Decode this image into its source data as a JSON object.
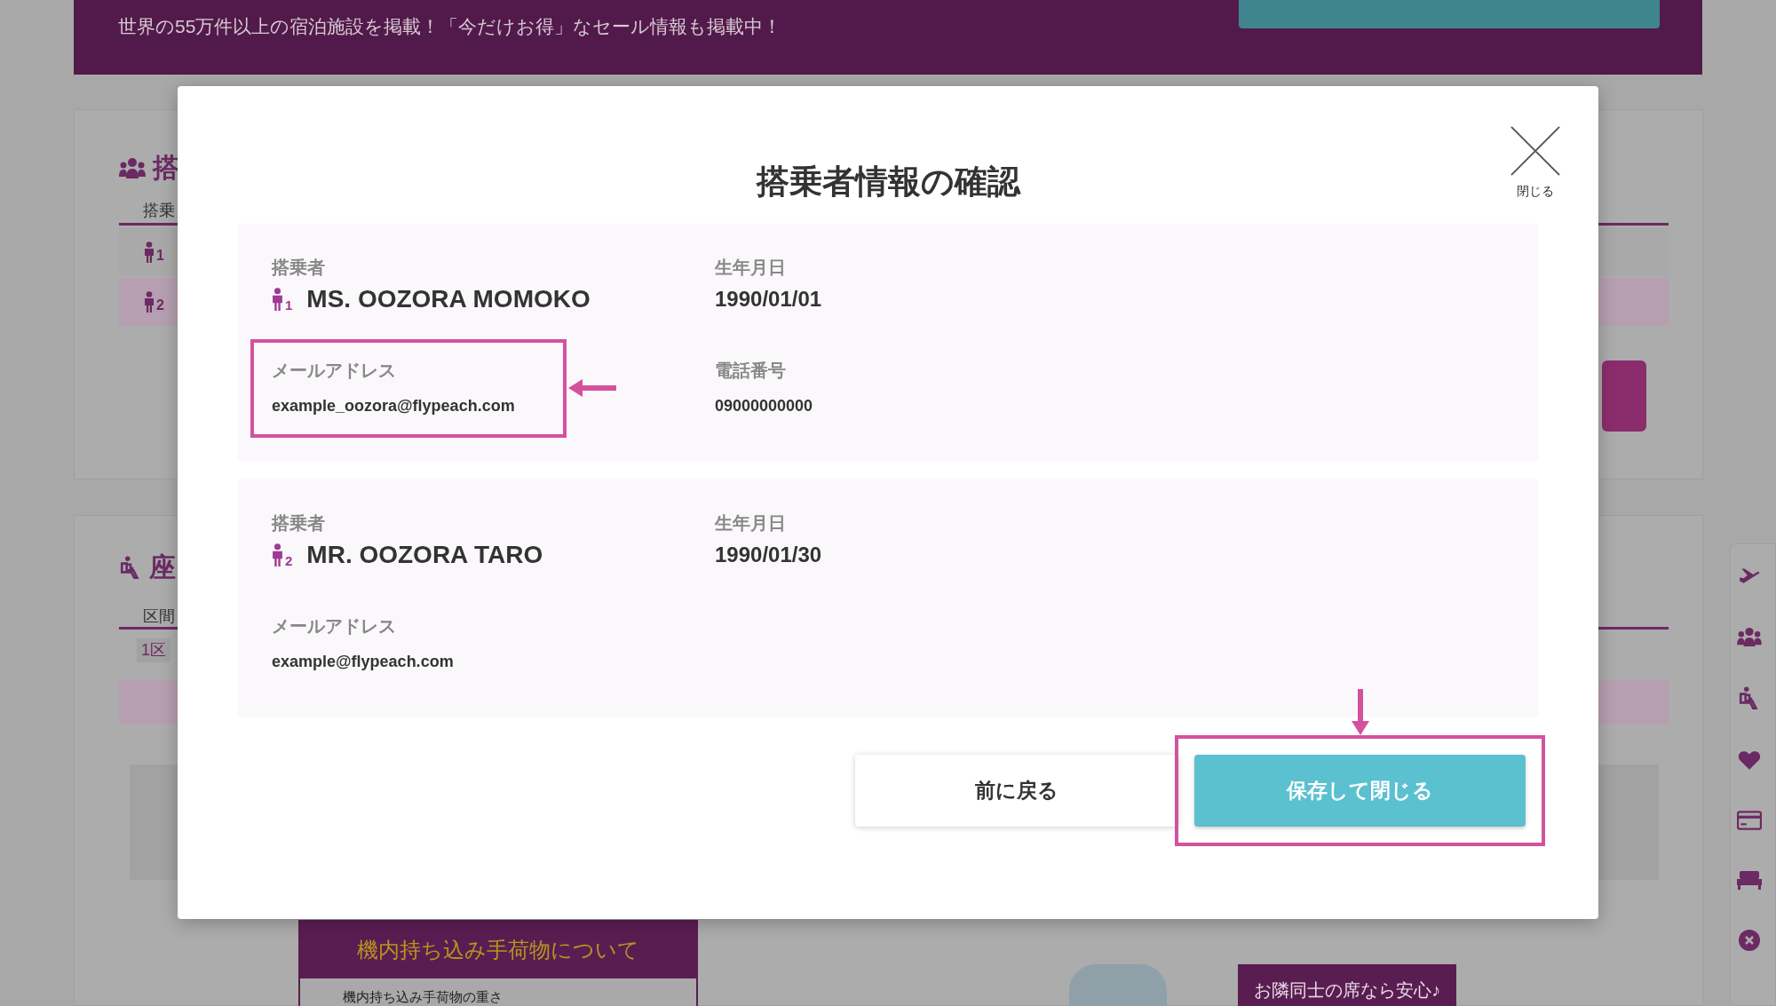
{
  "background": {
    "banner_subtitle": "世界の55万件以上の宿泊施設を掲載！「今だけお得」なセール情報も掲載中！",
    "passenger_section": {
      "heading": "搭",
      "column": "搭乗",
      "rows": [
        {
          "number": "1",
          "selected": false
        },
        {
          "number": "2",
          "selected": true
        }
      ]
    },
    "seat_section": {
      "heading": "座",
      "column": "区間",
      "row": "1区"
    },
    "baggage_box": {
      "title": "機内持ち込み手荷物について",
      "item": "機内持ち込み手荷物の重さ"
    },
    "seat_promo": "お隣同士の席なら安心♪"
  },
  "modal": {
    "title": "搭乗者情報の確認",
    "close_label": "閉じる",
    "passengers": [
      {
        "number": "1",
        "label": "搭乗者",
        "name": "MS. OOZORA MOMOKO",
        "birth_label": "生年月日",
        "birth": "1990/01/01",
        "email_label": "メールアドレス",
        "email": "example_oozora@flypeach.com",
        "phone_label": "電話番号",
        "phone": "09000000000",
        "highlighted": true
      },
      {
        "number": "2",
        "label": "搭乗者",
        "name": "MR. OOZORA TARO",
        "birth_label": "生年月日",
        "birth": "1990/01/30",
        "email_label": "メールアドレス",
        "email": "example@flypeach.com",
        "highlighted": false
      }
    ],
    "buttons": [
      {
        "kind": "secondary",
        "label": "前に戻る",
        "highlighted": false
      },
      {
        "kind": "primary",
        "label": "保存して閉じる",
        "highlighted": true
      }
    ]
  }
}
